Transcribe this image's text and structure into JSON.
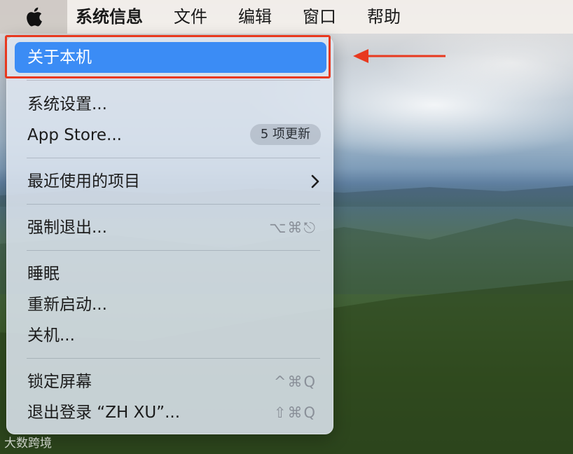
{
  "menubar": {
    "apple_icon": "apple-logo-icon",
    "app_name": "系统信息",
    "items": [
      "文件",
      "编辑",
      "窗口",
      "帮助"
    ]
  },
  "apple_menu": {
    "about": "关于本机",
    "system_settings": "系统设置...",
    "app_store": {
      "label": "App Store...",
      "badge": "5 项更新"
    },
    "recent_items": {
      "label": "最近使用的项目",
      "submenu_icon": "chevron-right-icon"
    },
    "force_quit": {
      "label": "强制退出...",
      "shortcut": "⌥⌘⎋"
    },
    "sleep": "睡眠",
    "restart": "重新启动...",
    "shutdown": "关机...",
    "lock_screen": {
      "label": "锁定屏幕",
      "shortcut": "^⌘Q"
    },
    "logout": {
      "label": "退出登录 “ZH XU”...",
      "shortcut": "⇧⌘Q"
    }
  },
  "annotation": {
    "color": "#e8391f"
  },
  "watermark": {
    "text": "大数跨境"
  },
  "colors": {
    "highlight": "#3b8cf5",
    "shortcut_text": "#8a9099"
  }
}
